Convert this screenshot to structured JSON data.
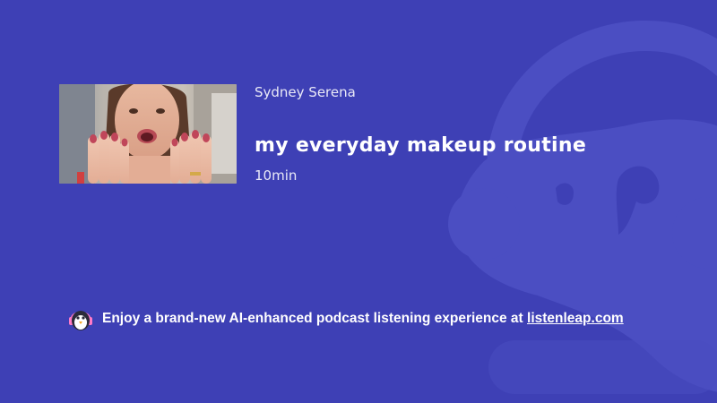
{
  "episode": {
    "author": "Sydney Serena",
    "title": "my everyday makeup routine",
    "duration": "10min"
  },
  "thumbnail": {
    "description_icon": "video-thumbnail-image"
  },
  "promo": {
    "text": "Enjoy a brand-new AI-enhanced podcast listening experience at",
    "link_text": "listenleap.com",
    "logo_icon": "penguin-headphones-icon"
  },
  "colors": {
    "background": "#3e40b5",
    "watermark": "#4a4fc2",
    "text": "#ffffff"
  }
}
